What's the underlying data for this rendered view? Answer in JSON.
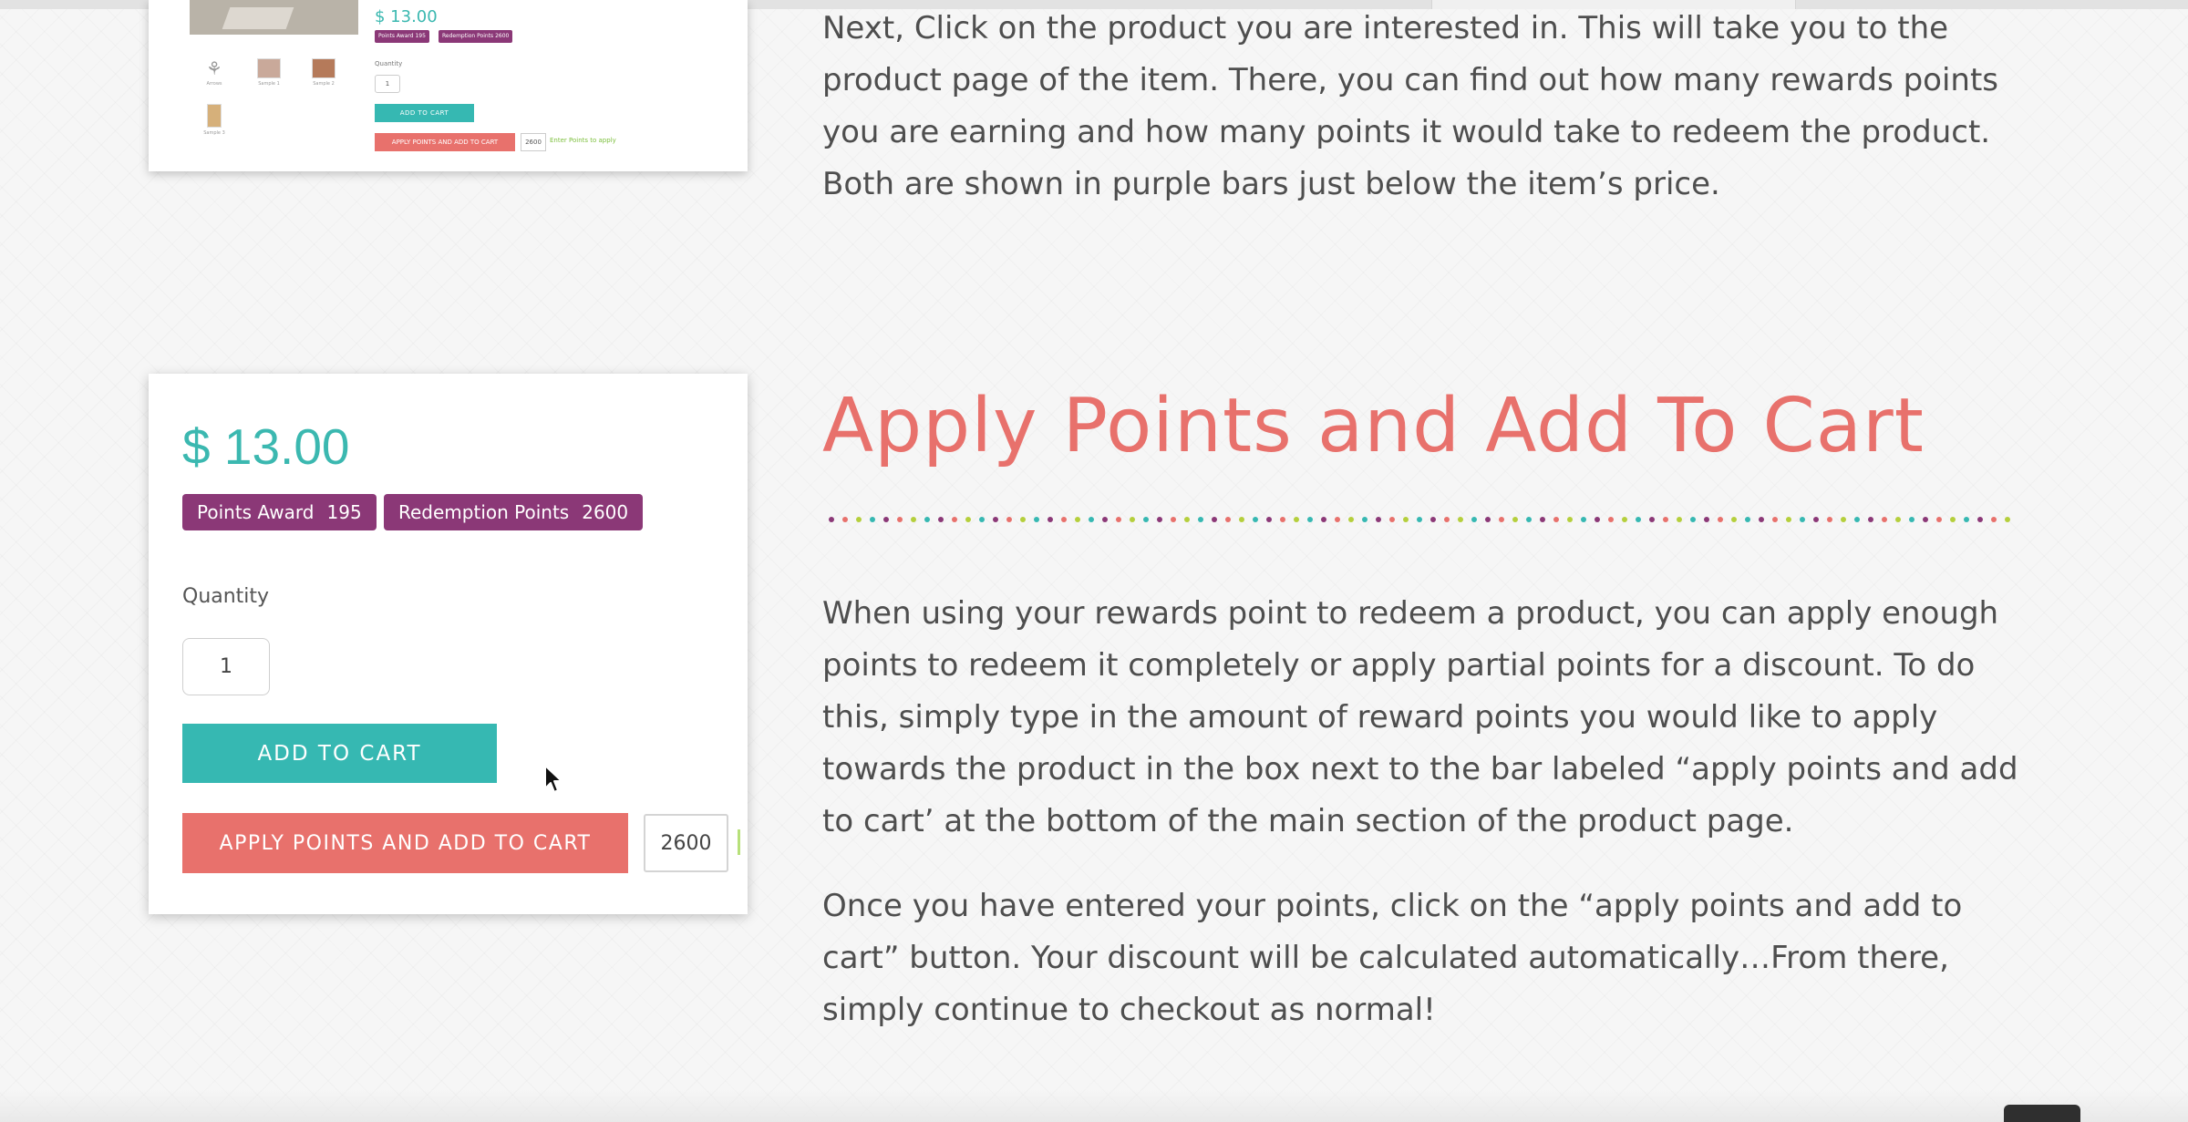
{
  "mini_card": {
    "thumbnails": [
      "Arrows",
      "Sample 1",
      "Sample 2",
      "Sample 3"
    ],
    "price": "$ 13.00",
    "points_award_badge": "Points Award 195",
    "redemption_badge": "Redemption Points 2600",
    "quantity_label": "Quantity",
    "quantity_value": "1",
    "add_to_cart": "ADD TO CART",
    "apply_points": "APPLY POINTS AND ADD TO CART",
    "points_value": "2600",
    "points_hint": "Enter Points to apply"
  },
  "intro_paragraph": "Next, Click on the product you are interested in. This will take you to the product page of the item. There, you can find out how many rewards points you are earning and how many points it would take to redeem the product. Both are shown in purple bars just below the item’s price.",
  "product_card": {
    "price": "$ 13.00",
    "points_award_label": "Points Award",
    "points_award_value": "195",
    "redemption_label": "Redemption Points",
    "redemption_value": "2600",
    "quantity_label": "Quantity",
    "quantity_value": "1",
    "add_to_cart_label": "ADD TO CART",
    "apply_points_label": "APPLY POINTS AND ADD TO CART",
    "points_input_value": "2600"
  },
  "section": {
    "heading": "Apply Points and Add To Cart",
    "divider_colors": [
      "#8b3877",
      "#e8716c",
      "#b5cf3c",
      "#36b8b2"
    ],
    "paragraph_1": "When using your rewards point to redeem a product, you can apply enough points to redeem it completely or apply partial points for a discount. To do this, simply type in the amount of reward points you would like to apply towards the product in the box next to the bar labeled “apply points and add to cart’ at the bottom of the main section of the product page.",
    "paragraph_2": "Once you have entered your points, click on the “apply points and add to cart” button. Your discount will be calculated automatically…From there, simply continue to checkout as normal!"
  },
  "colors": {
    "teal": "#36b8b2",
    "coral": "#e8716c",
    "purple": "#8b3877"
  }
}
